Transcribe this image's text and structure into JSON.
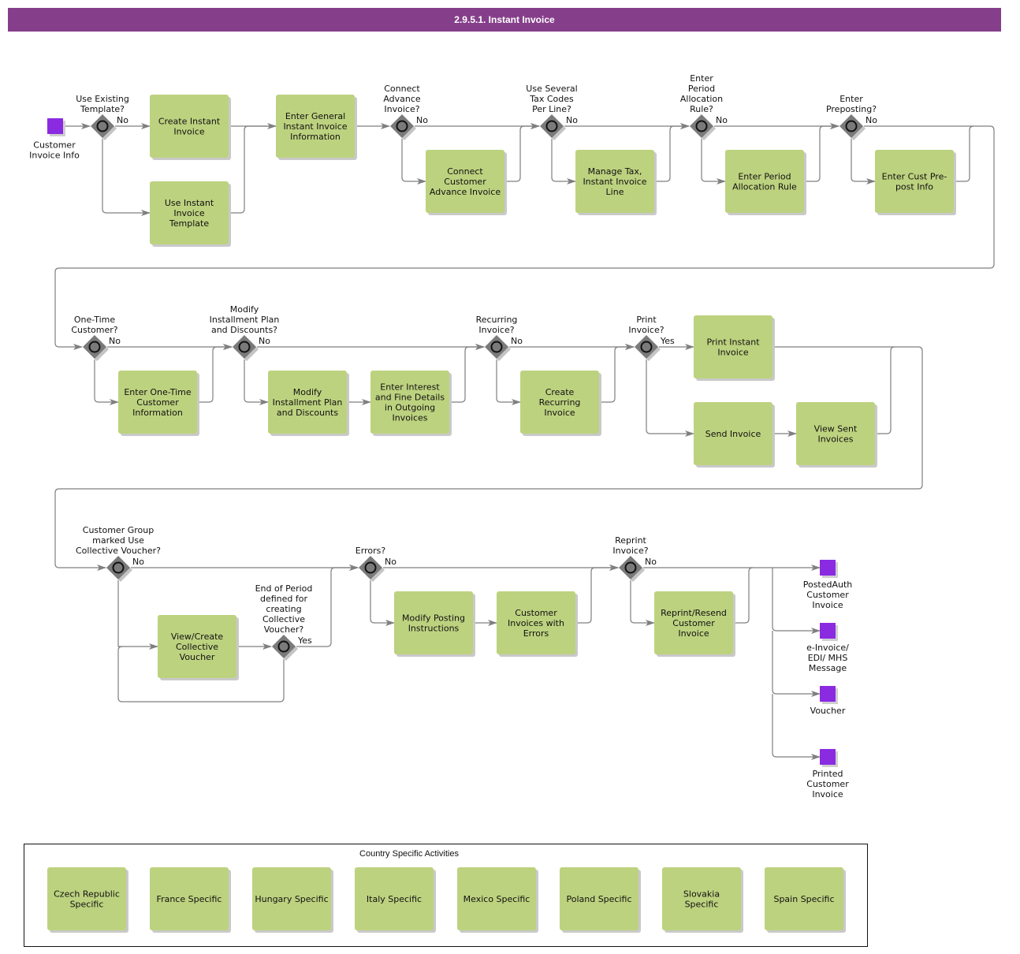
{
  "title": "2.9.5.1. Instant Invoice",
  "colors": {
    "title_bar": "#853f8a",
    "task": "#bdd27f",
    "event": "#8a2be2",
    "gateway": "#7a7a7a",
    "line": "#7f7f7f"
  },
  "start_event": {
    "label": [
      "Customer",
      "Invoice Info"
    ]
  },
  "gateways": [
    {
      "id": "g1",
      "question": [
        "Use Existing",
        "Template?"
      ],
      "branch_label": "No"
    },
    {
      "id": "g2",
      "question": [
        "Connect",
        "Advance",
        "Invoice?"
      ],
      "branch_label": "No"
    },
    {
      "id": "g3",
      "question": [
        "Use Several",
        "Tax Codes",
        "Per Line?"
      ],
      "branch_label": "No"
    },
    {
      "id": "g4",
      "question": [
        "Enter",
        "Period",
        "Allocation",
        "Rule?"
      ],
      "branch_label": "No"
    },
    {
      "id": "g5",
      "question": [
        "Enter",
        "Preposting?"
      ],
      "branch_label": "No"
    },
    {
      "id": "g6",
      "question": [
        "One-Time",
        "Customer?"
      ],
      "branch_label": "No"
    },
    {
      "id": "g7",
      "question": [
        "Modify",
        "Installment Plan",
        "and Discounts?"
      ],
      "branch_label": "No"
    },
    {
      "id": "g8",
      "question": [
        "Recurring",
        "Invoice?"
      ],
      "branch_label": "No"
    },
    {
      "id": "g9",
      "question": [
        "Print",
        "Invoice?"
      ],
      "branch_label": "Yes"
    },
    {
      "id": "g10",
      "question": [
        "Customer Group",
        "marked Use",
        "Collective Voucher?"
      ],
      "branch_label": "No"
    },
    {
      "id": "g11",
      "question": [
        "End of Period",
        "defined for",
        "creating",
        "Collective",
        "Voucher?"
      ],
      "branch_label": "Yes"
    },
    {
      "id": "g12",
      "question": [
        "Errors?"
      ],
      "branch_label": "No"
    },
    {
      "id": "g13",
      "question": [
        "Reprint",
        "Invoice?"
      ],
      "branch_label": "No"
    }
  ],
  "tasks": [
    {
      "id": "t1",
      "label": [
        "Create Instant",
        "Invoice"
      ]
    },
    {
      "id": "t2",
      "label": [
        "Use Instant",
        "Invoice",
        "Template"
      ]
    },
    {
      "id": "t3",
      "label": [
        "Enter General",
        "Instant Invoice",
        "Information"
      ]
    },
    {
      "id": "t4",
      "label": [
        "Connect",
        "Customer",
        "Advance Invoice"
      ]
    },
    {
      "id": "t5",
      "label": [
        "Manage Tax,",
        "Instant Invoice",
        "Line"
      ]
    },
    {
      "id": "t6",
      "label": [
        "Enter Period",
        "Allocation Rule"
      ]
    },
    {
      "id": "t7",
      "label": [
        "Enter Cust Pre-",
        "post Info"
      ]
    },
    {
      "id": "t8",
      "label": [
        "Enter One-Time",
        "Customer",
        "Information"
      ]
    },
    {
      "id": "t9",
      "label": [
        "Modify",
        "Installment Plan",
        "and Discounts"
      ]
    },
    {
      "id": "t10",
      "label": [
        "Enter Interest",
        "and Fine Details",
        "in Outgoing",
        "Invoices"
      ]
    },
    {
      "id": "t11",
      "label": [
        "Create",
        "Recurring",
        "Invoice"
      ]
    },
    {
      "id": "t12",
      "label": [
        "Print Instant",
        "Invoice"
      ]
    },
    {
      "id": "t13",
      "label": [
        "Send Invoice"
      ]
    },
    {
      "id": "t14",
      "label": [
        "View Sent",
        "Invoices"
      ]
    },
    {
      "id": "t15",
      "label": [
        "View/Create",
        "Collective",
        "Voucher"
      ]
    },
    {
      "id": "t16",
      "label": [
        "Modify Posting",
        "Instructions"
      ]
    },
    {
      "id": "t17",
      "label": [
        "Customer",
        "Invoices with",
        "Errors"
      ]
    },
    {
      "id": "t18",
      "label": [
        "Reprint/Resend",
        "Customer",
        "Invoice"
      ]
    }
  ],
  "end_events": [
    {
      "id": "e1",
      "label": [
        "PostedAuth",
        "Customer",
        "Invoice"
      ]
    },
    {
      "id": "e2",
      "label": [
        "e-Invoice/",
        "EDI/ MHS",
        "Message"
      ]
    },
    {
      "id": "e3",
      "label": [
        "Voucher"
      ]
    },
    {
      "id": "e4",
      "label": [
        "Printed",
        "Customer",
        "Invoice"
      ]
    }
  ],
  "country_group": {
    "title": "Country Specific Activities",
    "items": [
      {
        "label": [
          "Czech Republic",
          "Specific"
        ]
      },
      {
        "label": [
          "France Specific"
        ]
      },
      {
        "label": [
          "Hungary Specific"
        ]
      },
      {
        "label": [
          "Italy Specific"
        ]
      },
      {
        "label": [
          "Mexico Specific"
        ]
      },
      {
        "label": [
          "Poland Specific"
        ]
      },
      {
        "label": [
          "Slovakia",
          "Specific"
        ]
      },
      {
        "label": [
          "Spain Specific"
        ]
      }
    ]
  }
}
